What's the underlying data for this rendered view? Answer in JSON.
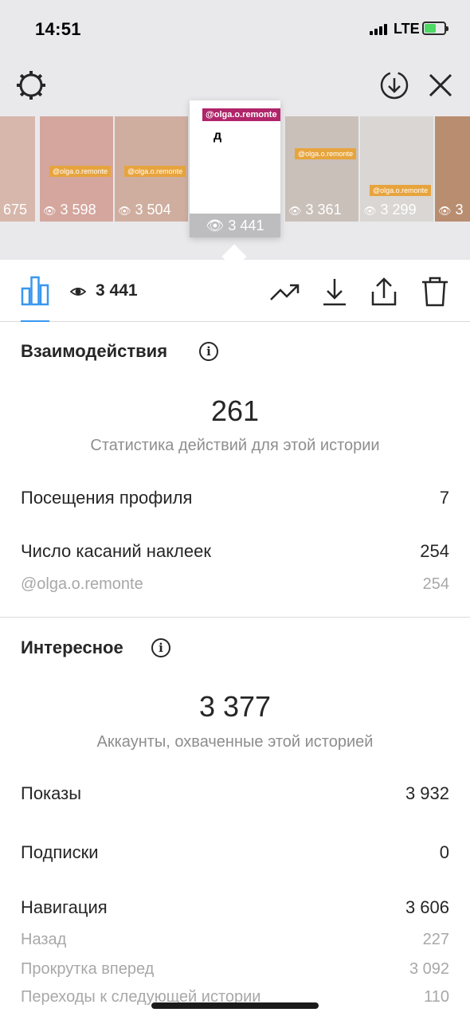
{
  "status_bar": {
    "time": "14:51",
    "network": "LTE"
  },
  "stories": [
    {
      "views": "675",
      "tag": ""
    },
    {
      "views": "3 598",
      "tag": "@olga.o.remonte"
    },
    {
      "views": "3 504",
      "tag": "@olga.o.remonte"
    },
    {
      "views": "3 361",
      "tag": "@olga.o.remonte"
    },
    {
      "views": "3 299",
      "tag": "@olga.o.remonte"
    },
    {
      "views": "3",
      "tag": ""
    }
  ],
  "selected_story": {
    "tag": "@olga.o.remonte",
    "text": "д",
    "views": "3 441"
  },
  "actionbar": {
    "views": "3 441"
  },
  "interactions": {
    "title": "Взаимодействия",
    "total": "261",
    "subtitle": "Статистика действий для этой истории",
    "rows": [
      {
        "label": "Посещения профиля",
        "value": "7"
      },
      {
        "label": "Число касаний наклеек",
        "value": "254"
      }
    ],
    "sub_rows": [
      {
        "label": "@olga.o.remonte",
        "value": "254"
      }
    ]
  },
  "discovery": {
    "title": "Интересное",
    "total": "3 377",
    "subtitle": "Аккаунты, охваченные этой историей",
    "rows": [
      {
        "label": "Показы",
        "value": "3 932"
      },
      {
        "label": "Подписки",
        "value": "0"
      },
      {
        "label": "Навигация",
        "value": "3 606"
      }
    ],
    "nav_rows": [
      {
        "label": "Назад",
        "value": "227"
      },
      {
        "label": "Прокрутка вперед",
        "value": "3 092"
      },
      {
        "label": "Переходы к следующей истории",
        "value": "110"
      }
    ]
  },
  "colors": {
    "accent": "#3897f0",
    "tag_pink": "#b0246a",
    "tag_orange": "#e7a43d"
  }
}
